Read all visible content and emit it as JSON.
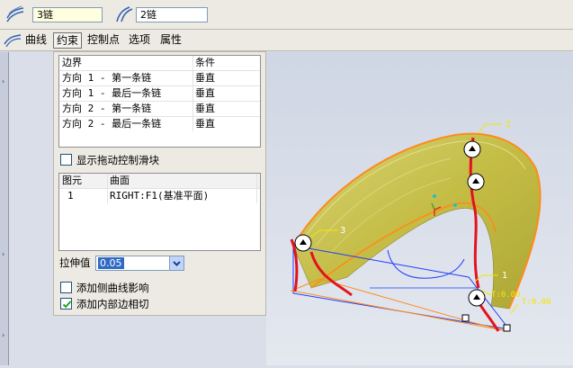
{
  "dashboard": {
    "field1": "3链",
    "field2": "2链"
  },
  "tabs": [
    "曲线",
    "约束",
    "控制点",
    "选项",
    "属性"
  ],
  "active_tab": "约束",
  "boundary_table": {
    "headers": [
      "边界",
      "条件"
    ],
    "rows": [
      [
        "方向 1 - 第一条链",
        "垂直"
      ],
      [
        "方向 1 - 最后一条链",
        "垂直"
      ],
      [
        "方向 2 - 第一条链",
        "垂直"
      ],
      [
        "方向 2 - 最后一条链",
        "垂直"
      ]
    ]
  },
  "show_drag_handles_label": "显示拖动控制滑块",
  "elements_table": {
    "headers": [
      "图元",
      "曲面"
    ],
    "rows": [
      [
        "1",
        "RIGHT:F1(基准平面)"
      ]
    ]
  },
  "stretch_label": "拉伸值",
  "stretch_value": "0.05",
  "add_side_curve_label": "添加侧曲线影响",
  "add_inner_edge_label": "添加内部边相切",
  "options": {
    "show_drag_handles": false,
    "add_side_curve": false,
    "add_inner_edge": true
  },
  "viewport_labels": {
    "label_2": "2",
    "label_3": "3",
    "label_1": "1",
    "t_label_a": "T:0.00",
    "t_label_b": "T:0.00"
  },
  "colors": {
    "surface": "#c8c24a",
    "edge_orange": "#ff8a1c",
    "edge_red": "#e3121e",
    "selection_blue": "#1e3cff",
    "annotation_yellow": "#f2e600"
  }
}
